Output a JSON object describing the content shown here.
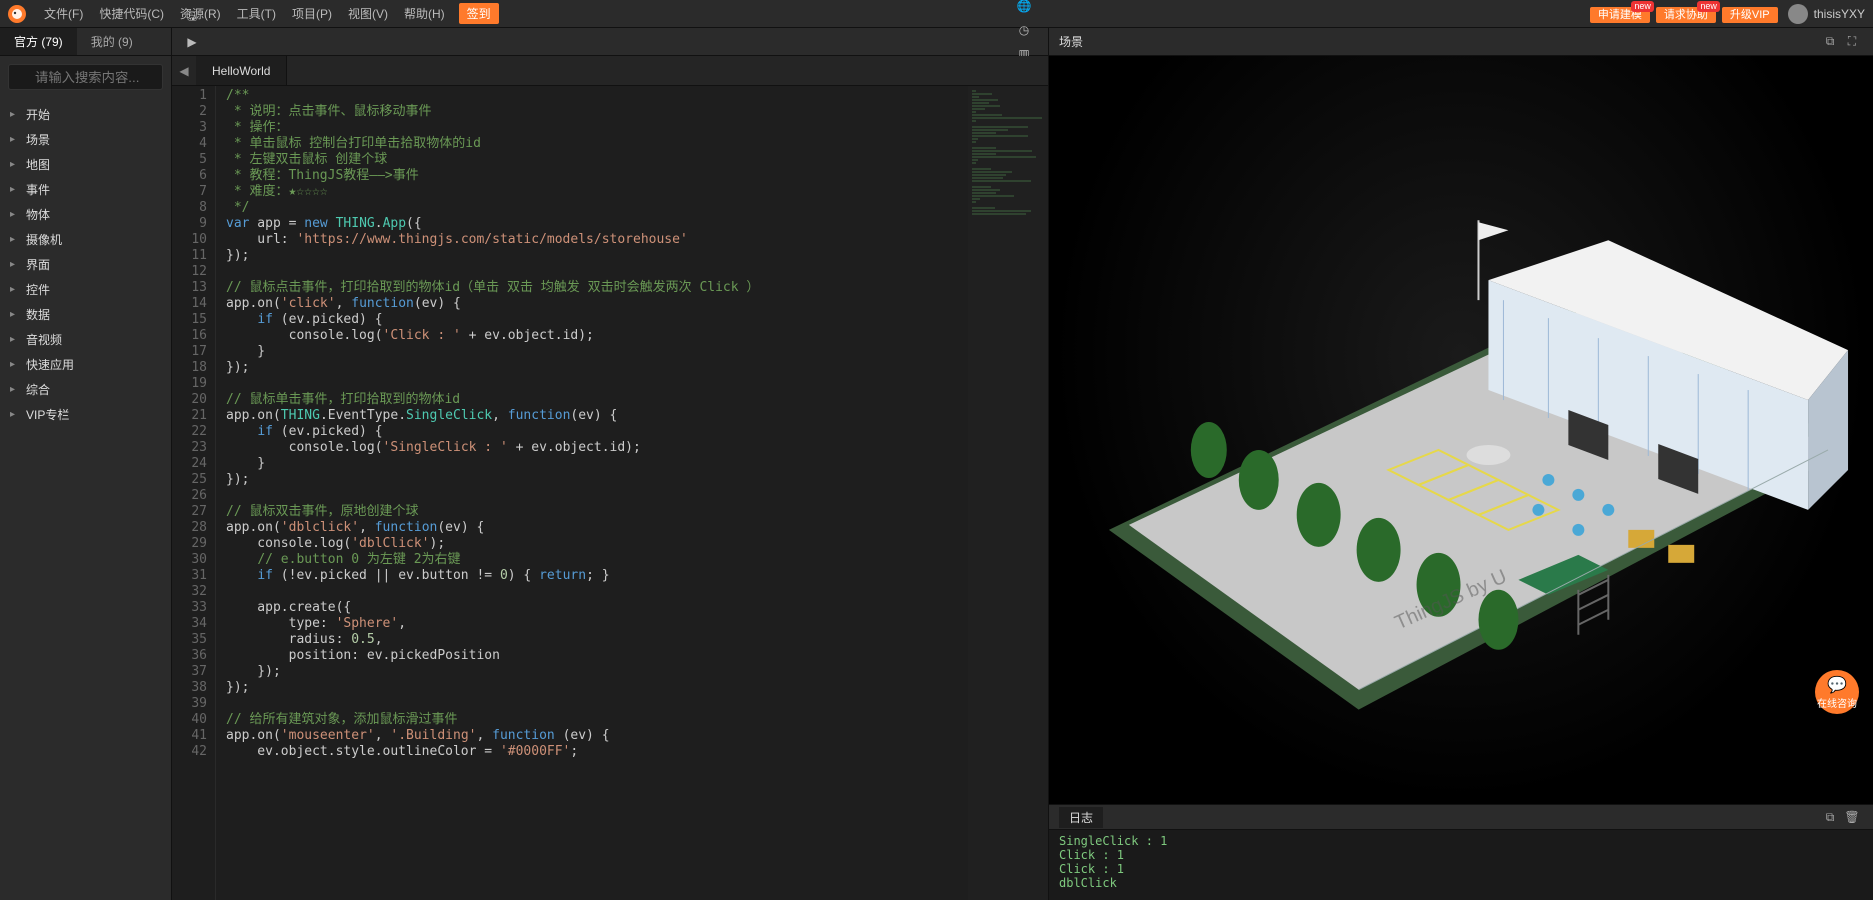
{
  "menu": {
    "items": [
      "文件(F)",
      "快捷代码(C)",
      "资源(R)",
      "工具(T)",
      "项目(P)",
      "视图(V)",
      "帮助(H)"
    ],
    "signin": "签到",
    "right_buttons": [
      {
        "label": "申请建模",
        "badge": "new"
      },
      {
        "label": "请求协助",
        "badge": "new"
      },
      {
        "label": "升级VIP",
        "badge": ""
      }
    ],
    "username": "thisisYXY"
  },
  "left": {
    "tabs": [
      {
        "label": "官方 (79)",
        "active": true
      },
      {
        "label": "我的 (9)",
        "active": false
      }
    ],
    "search_placeholder": "请输入搜索内容...",
    "tree": [
      "开始",
      "场景",
      "地图",
      "事件",
      "物体",
      "摄像机",
      "界面",
      "控件",
      "数据",
      "音视频",
      "快速应用",
      "综合",
      "VIP专栏"
    ]
  },
  "toolbar": {
    "left_icons": [
      "plus-icon",
      "save-icon",
      "run-icon",
      "share-icon",
      "download-icon"
    ],
    "right_icons": [
      "globe-icon",
      "cube-icon",
      "panel-icon",
      "web-icon",
      "clock-icon",
      "layout1-icon",
      "layout2-icon",
      "image-icon",
      "sidebar-icon",
      "list-icon"
    ]
  },
  "tabs": {
    "open": [
      "HelloWorld"
    ]
  },
  "editor": {
    "lines": [
      {
        "n": 1,
        "html": "<span class='tok-c'>/**</span>"
      },
      {
        "n": 2,
        "html": "<span class='tok-c'> * 说明：点击事件、鼠标移动事件</span>"
      },
      {
        "n": 3,
        "html": "<span class='tok-c'> * 操作：</span>"
      },
      {
        "n": 4,
        "html": "<span class='tok-c'> * 单击鼠标 控制台打印单击拾取物体的id</span>"
      },
      {
        "n": 5,
        "html": "<span class='tok-c'> * 左键双击鼠标 创建个球</span>"
      },
      {
        "n": 6,
        "html": "<span class='tok-c'> * 教程：ThingJS教程——&gt;事件</span>"
      },
      {
        "n": 7,
        "html": "<span class='tok-c'> * 难度：★☆☆☆☆</span>"
      },
      {
        "n": 8,
        "html": "<span class='tok-c'> */</span>"
      },
      {
        "n": 9,
        "html": "<span class='tok-k'>var</span> app = <span class='tok-k'>new</span> <span class='tok-t'>THING</span>.<span class='tok-t'>App</span>({"
      },
      {
        "n": 10,
        "html": "    url: <span class='tok-s'>'https://www.thingjs.com/static/models/storehouse'</span>"
      },
      {
        "n": 11,
        "html": "});"
      },
      {
        "n": 12,
        "html": ""
      },
      {
        "n": 13,
        "html": "<span class='tok-c'>// 鼠标点击事件，打印拾取到的物体id（单击 双击 均触发 双击时会触发两次 Click ）</span>"
      },
      {
        "n": 14,
        "html": "app.on(<span class='tok-s'>'click'</span>, <span class='tok-k'>function</span>(ev) {"
      },
      {
        "n": 15,
        "html": "    <span class='tok-k'>if</span> (ev.picked) {"
      },
      {
        "n": 16,
        "html": "        console.log(<span class='tok-s'>'Click : '</span> + ev.object.id);"
      },
      {
        "n": 17,
        "html": "    }"
      },
      {
        "n": 18,
        "html": "});"
      },
      {
        "n": 19,
        "html": ""
      },
      {
        "n": 20,
        "html": "<span class='tok-c'>// 鼠标单击事件，打印拾取到的物体id</span>"
      },
      {
        "n": 21,
        "html": "app.on(<span class='tok-t'>THING</span>.EventType.<span class='tok-t'>SingleClick</span>, <span class='tok-k'>function</span>(ev) {"
      },
      {
        "n": 22,
        "html": "    <span class='tok-k'>if</span> (ev.picked) {"
      },
      {
        "n": 23,
        "html": "        console.log(<span class='tok-s'>'SingleClick : '</span> + ev.object.id);"
      },
      {
        "n": 24,
        "html": "    }"
      },
      {
        "n": 25,
        "html": "});"
      },
      {
        "n": 26,
        "html": ""
      },
      {
        "n": 27,
        "html": "<span class='tok-c'>// 鼠标双击事件，原地创建个球</span>"
      },
      {
        "n": 28,
        "html": "app.on(<span class='tok-s'>'dblclick'</span>, <span class='tok-k'>function</span>(ev) {"
      },
      {
        "n": 29,
        "html": "    console.log(<span class='tok-s'>'dblClick'</span>);"
      },
      {
        "n": 30,
        "html": "    <span class='tok-c'>// e.button 0 为左键 2为右键</span>"
      },
      {
        "n": 31,
        "html": "    <span class='tok-k'>if</span> (!ev.picked || ev.button != <span class='tok-n'>0</span>) { <span class='tok-k'>return</span>; }"
      },
      {
        "n": 32,
        "html": ""
      },
      {
        "n": 33,
        "html": "    app.create({"
      },
      {
        "n": 34,
        "html": "        type: <span class='tok-s'>'Sphere'</span>,"
      },
      {
        "n": 35,
        "html": "        radius: <span class='tok-n'>0.5</span>,"
      },
      {
        "n": 36,
        "html": "        position: ev.pickedPosition"
      },
      {
        "n": 37,
        "html": "    });"
      },
      {
        "n": 38,
        "html": "});"
      },
      {
        "n": 39,
        "html": ""
      },
      {
        "n": 40,
        "html": "<span class='tok-c'>// 给所有建筑对象，添加鼠标滑过事件</span>"
      },
      {
        "n": 41,
        "html": "app.on(<span class='tok-s'>'mouseenter'</span>, <span class='tok-s'>'.Building'</span>, <span class='tok-k'>function</span> (ev) {"
      },
      {
        "n": 42,
        "html": "    ev.object.style.outlineColor = <span class='tok-s'>'#0000FF'</span>;"
      }
    ]
  },
  "scene": {
    "title": "场景",
    "watermark": "ThingJS by U"
  },
  "log": {
    "title": "日志",
    "lines": [
      "SingleClick : 1",
      "Click : 1",
      "Click : 1",
      "dblClick"
    ]
  },
  "chat": {
    "label": "在线咨询"
  }
}
